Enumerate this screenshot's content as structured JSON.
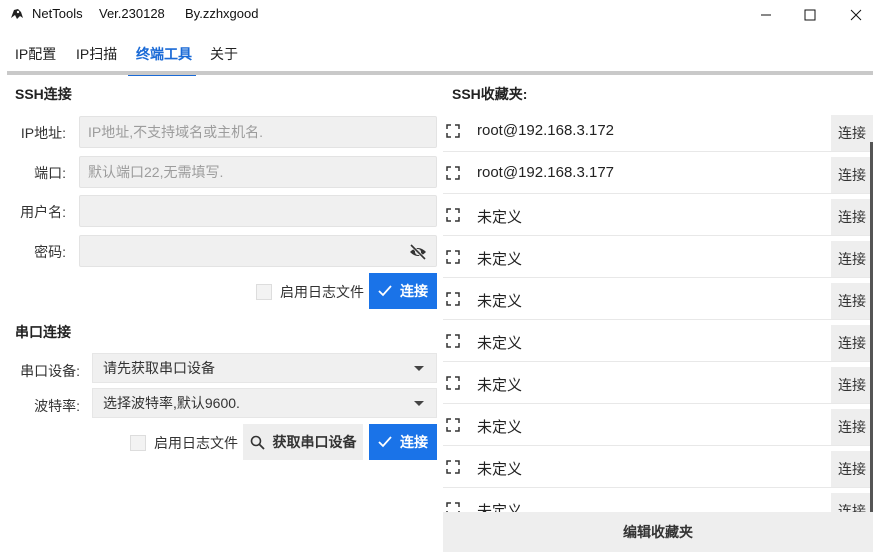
{
  "titlebar": {
    "app_name": "NetTools",
    "version": "Ver.230128",
    "author": "By.zzhxgood",
    "minimize": "─",
    "maximize": "☐",
    "close": "✕"
  },
  "tabs": [
    {
      "label": "IP配置"
    },
    {
      "label": "IP扫描"
    },
    {
      "label": "终端工具",
      "active": true
    },
    {
      "label": "关于"
    }
  ],
  "ssh": {
    "title": "SSH连接",
    "ip_label": "IP地址:",
    "ip_placeholder": "IP地址,不支持域名或主机名.",
    "port_label": "端口:",
    "port_placeholder": "默认端口22,无需填写.",
    "user_label": "用户名:",
    "user_value": "",
    "password_label": "密码:",
    "password_value": "",
    "log_label": "启用日志文件",
    "connect_label": "连接"
  },
  "serial": {
    "title": "串口连接",
    "device_label": "串口设备:",
    "device_value": "请先获取串口设备",
    "baud_label": "波特率:",
    "baud_value": "选择波特率,默认9600.",
    "log_label": "启用日志文件",
    "fetch_label": "获取串口设备",
    "connect_label": "连接"
  },
  "favorites": {
    "title": "SSH收藏夹:",
    "items": [
      {
        "name": "root@192.168.3.172",
        "button": "连接"
      },
      {
        "name": "root@192.168.3.177",
        "button": "连接"
      },
      {
        "name": "未定义",
        "button": "连接"
      },
      {
        "name": "未定义",
        "button": "连接"
      },
      {
        "name": "未定义",
        "button": "连接"
      },
      {
        "name": "未定义",
        "button": "连接"
      },
      {
        "name": "未定义",
        "button": "连接"
      },
      {
        "name": "未定义",
        "button": "连接"
      },
      {
        "name": "未定义",
        "button": "连接"
      },
      {
        "name": "未定义",
        "button": "连接"
      }
    ],
    "edit_label": "编辑收藏夹"
  },
  "colors": {
    "accent": "#1a73e8",
    "field_bg": "#f0f0f0"
  }
}
